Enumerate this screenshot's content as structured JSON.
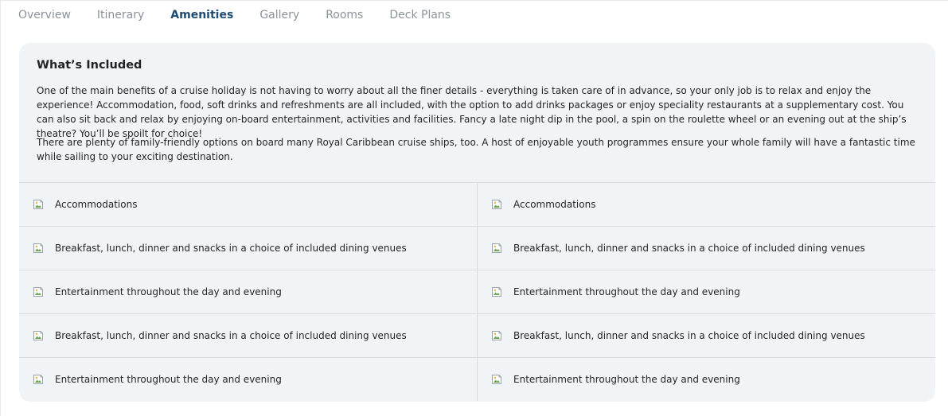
{
  "tabs": [
    {
      "label": "Overview",
      "active": false
    },
    {
      "label": "Itinerary",
      "active": false
    },
    {
      "label": "Amenities",
      "active": true
    },
    {
      "label": "Gallery",
      "active": false
    },
    {
      "label": "Rooms",
      "active": false
    },
    {
      "label": "Deck Plans",
      "active": false
    }
  ],
  "section": {
    "title": "What’s Included",
    "paragraph1": "One of the main benefits of a cruise holiday is not having to worry about all the finer details - everything is taken care of in advance, so your only job is to relax and enjoy the experience! Accommodation, food, soft drinks and refreshments are all included, with the option to add drinks packages or enjoy speciality restaurants at a supplementary cost. You can also sit back and relax by enjoying on-board entertainment, activities and facilities. Fancy a late night dip in the pool, a spin on the roulette wheel or an evening out at the ship’s theatre? You’ll be spoilt for choice!",
    "paragraph2": "There are plenty of family-friendly options on board many Royal Caribbean cruise ships, too. A host of enjoyable youth programmes ensure your whole family will have a fantastic time while sailing to your exciting destination."
  },
  "amenities": {
    "rows": [
      {
        "left": "Accommodations",
        "right": "Accommodations"
      },
      {
        "left": "Breakfast, lunch, dinner and snacks in a choice of included dining venues",
        "right": "Breakfast, lunch, dinner and snacks in a choice of included dining venues"
      },
      {
        "left": "Entertainment throughout the day and evening",
        "right": "Entertainment throughout the day and evening"
      },
      {
        "left": "Breakfast, lunch, dinner and snacks in a choice of included dining venues",
        "right": "Breakfast, lunch, dinner and snacks in a choice of included dining venues"
      },
      {
        "left": "Entertainment throughout the day and evening",
        "right": "Entertainment throughout the day and evening"
      }
    ],
    "icon": "broken-image-icon"
  },
  "colors": {
    "active_tab": "#1e4b73",
    "inactive_tab": "#8a929c",
    "card_background": "#f1f4f7",
    "divider": "#d8dde3"
  }
}
